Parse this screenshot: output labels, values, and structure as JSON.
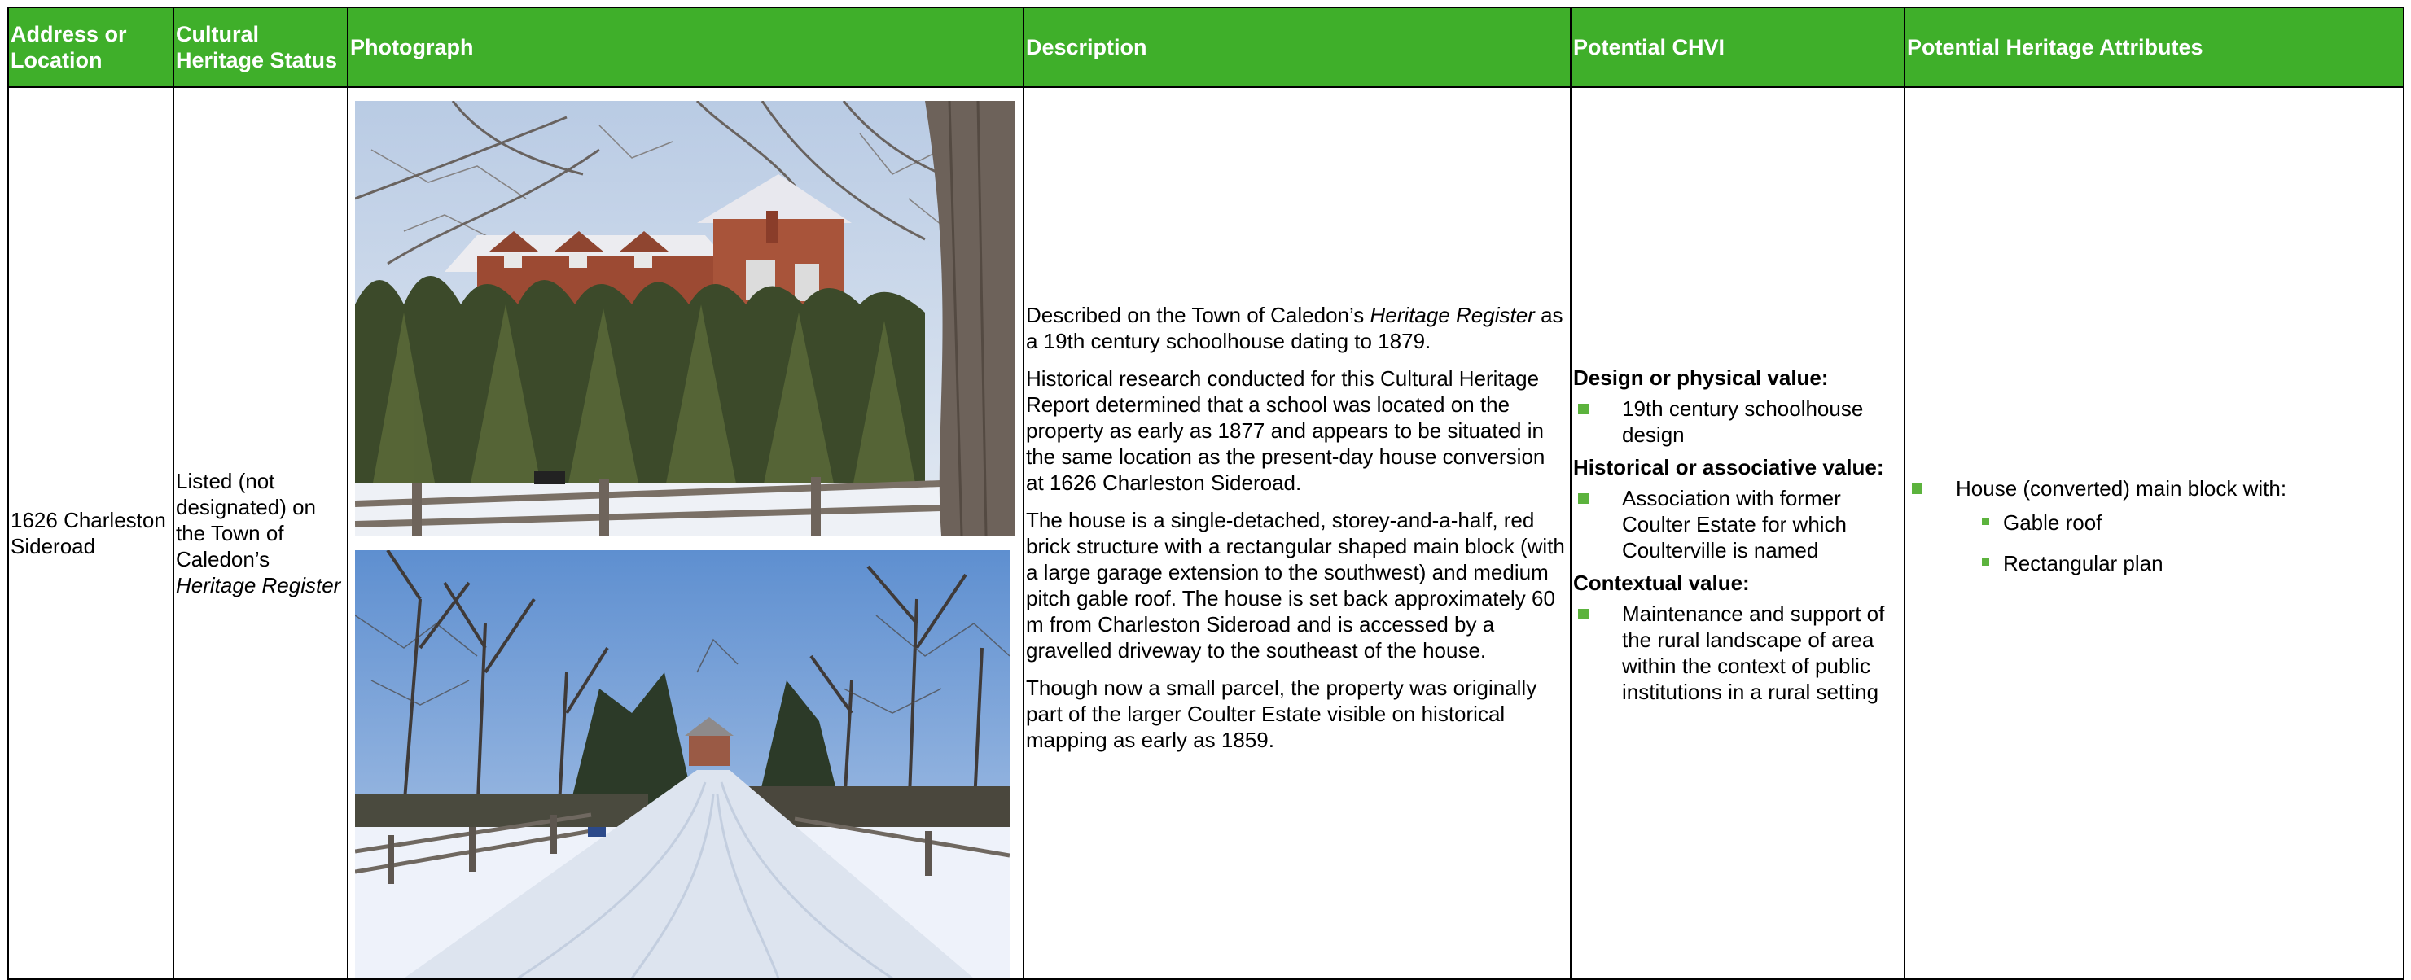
{
  "headers": {
    "address": "Address or Location",
    "status": "Cultural Heritage Status",
    "photograph": "Photograph",
    "description": "Description",
    "chvi": "Potential CHVI",
    "attributes": "Potential Heritage Attributes"
  },
  "row": {
    "address": "1626 Charleston Sideroad",
    "status_text": "Listed (not designated) on the Town of Caledon’s",
    "status_register": "Heritage Register",
    "description": {
      "p1_pre": "Described on the Town of Caledon’s ",
      "p1_italic": "Heritage Register",
      "p1_post": " as a 19th century schoolhouse dating to 1879.",
      "p2": "Historical research conducted for this Cultural Heritage Report determined that a school was located on the property as early as 1877 and appears to be situated in the same location as the present-day house conversion at 1626 Charleston Sideroad.",
      "p3": "The house is a single-detached, storey-and-a-half, red brick structure with a rectangular shaped main block (with a large garage extension to the southwest) and medium pitch gable roof. The house is set back approximately 60 m from Charleston Sideroad and is accessed by a gravelled driveway to the southeast of the house.",
      "p4": "Though now a small parcel, the property was originally part of the larger Coulter Estate visible on historical mapping as early as 1859."
    },
    "chvi": {
      "design_head": "Design or physical value:",
      "design_items": [
        "19th century schoolhouse design"
      ],
      "historical_head": "Historical or associative value:",
      "historical_items": [
        "Association with former Coulter Estate for which Coulterville is named"
      ],
      "contextual_head": "Contextual value:",
      "contextual_items": [
        "Maintenance and support of the rural landscape of area within the context of public institutions in a rural setting"
      ]
    },
    "attributes": {
      "main": "House (converted) main block with:",
      "sub": [
        "Gable roof",
        "Rectangular plan"
      ]
    }
  },
  "colors": {
    "header_bg": "#3faf2a",
    "bullet": "#5cb33d"
  }
}
